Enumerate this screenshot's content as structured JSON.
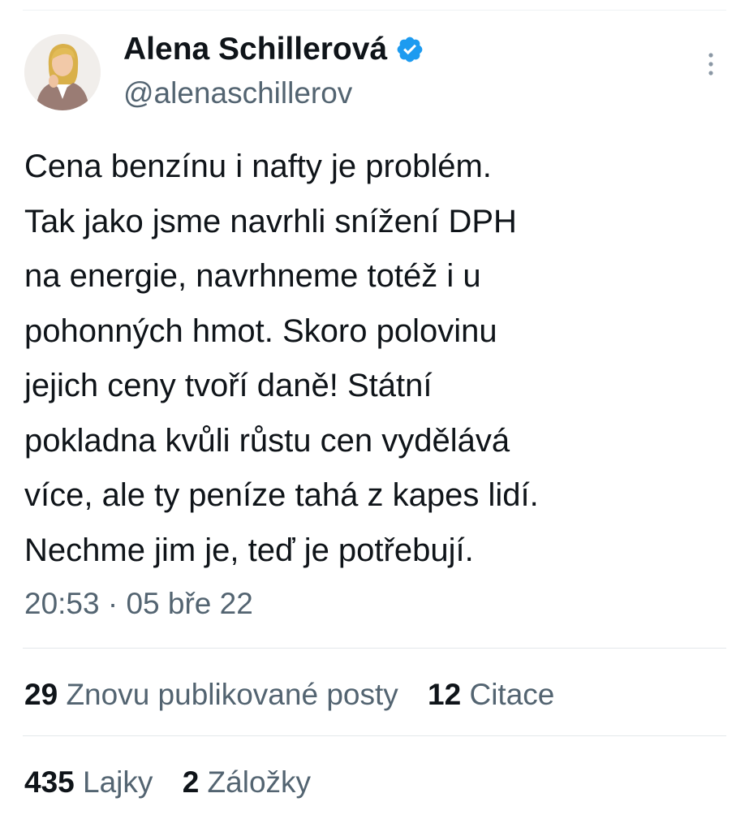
{
  "tweet": {
    "author": {
      "display_name": "Alena Schillerová",
      "handle": "@alenaschillerov",
      "verified": true
    },
    "text_lines": [
      "Cena benzínu i nafty je problém.",
      "Tak jako jsme navrhli snížení DPH",
      "na energie, navrhneme totéž i u",
      "pohonných hmot. Skoro polovinu",
      "jejich ceny tvoří daně! Státní",
      "pokladna kvůli růstu cen vydělává",
      "více, ale ty peníze tahá z kapes lidí.",
      "Nechme jim je, teď je potřebují."
    ],
    "timestamp": "20:53 · 05 bře 22",
    "stats": {
      "reposts": {
        "count": "29",
        "label": "Znovu publikované posty"
      },
      "quotes": {
        "count": "12",
        "label": "Citace"
      },
      "likes": {
        "count": "435",
        "label": "Lajky"
      },
      "bookmarks": {
        "count": "2",
        "label": "Záložky"
      }
    }
  },
  "icons": {
    "verified_badge": "verified-badge-icon",
    "more": "more-vertical-icon"
  },
  "colors": {
    "verified_blue": "#1d9bf0",
    "text_primary": "#0f1419",
    "text_secondary": "#536471",
    "divider": "#e3e8ea"
  }
}
